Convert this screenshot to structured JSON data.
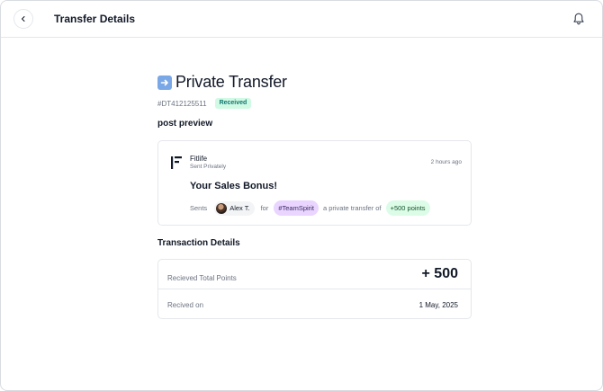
{
  "header": {
    "title": "Transfer Details"
  },
  "transfer": {
    "title": "Private Transfer",
    "title_icon": "right-arrow-emoji",
    "id": "#DT412125511",
    "status": "Received"
  },
  "post_preview": {
    "section_title": "post preview",
    "sender_name": "Fitlife",
    "sender_subtitle": "Sent Privately",
    "time_ago": "2 hours ago",
    "post_title": "Your Sales Bonus!",
    "line": {
      "prefix": "Sents",
      "user": "Alex T.",
      "for_text": "for",
      "tag": "#TeamSpirit",
      "middle_text": "a private transfer of",
      "points": "+500 points"
    }
  },
  "transaction_details": {
    "section_title": "Transaction Details",
    "total_points_label": "Recieved Total Points",
    "total_points_value": "+ 500",
    "received_on_label": "Recived on",
    "received_on_value": "1 May, 2025"
  },
  "colors": {
    "status_badge_bg": "#d1fae5",
    "status_badge_text": "#0f766e",
    "tag_bg": "#e9d5ff",
    "points_bg": "#dcfce7"
  }
}
